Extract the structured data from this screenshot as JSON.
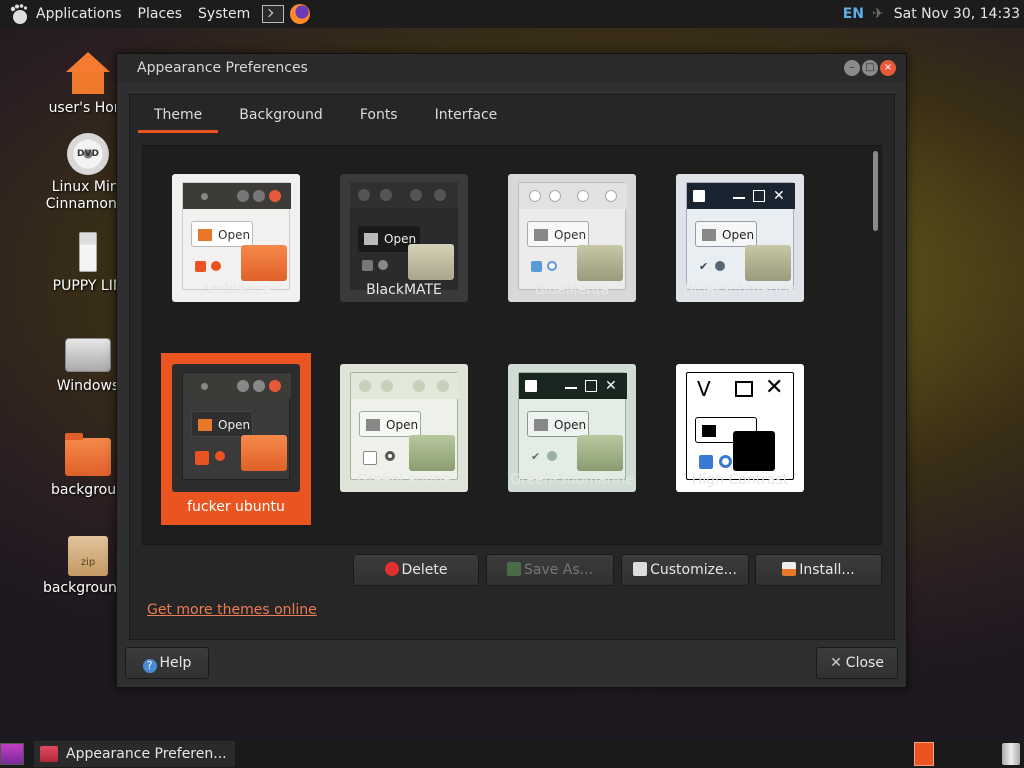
{
  "top_panel": {
    "menus": [
      "Applications",
      "Places",
      "System"
    ],
    "lang": "EN",
    "clock": "Sat Nov 30, 14:33"
  },
  "desktop": {
    "icons": [
      "user's Hom",
      "Linux Mint",
      "Cinnamon 6",
      "PUPPY LIN",
      "Windows",
      "backgroun",
      "backgrounds"
    ]
  },
  "window": {
    "title": "Appearance Preferences",
    "tabs": [
      "Theme",
      "Background",
      "Fonts",
      "Interface"
    ],
    "themes": [
      {
        "name": "Ambiance"
      },
      {
        "name": "BlackMATE"
      },
      {
        "name": "BlueMenta"
      },
      {
        "name": "Blue-Submarine"
      },
      {
        "name": "fucker ubuntu"
      },
      {
        "name": "GreenLaguna"
      },
      {
        "name": "Green-Submarine"
      },
      {
        "name": "High Contrast"
      }
    ],
    "mini_open_label": "Open",
    "buttons": {
      "delete": "Delete",
      "save_as": "Save As...",
      "customize": "Customize...",
      "install": "Install..."
    },
    "more_link": "Get more themes online",
    "help": "Help",
    "close": "Close",
    "colors": {
      "accent": "#e95420",
      "link": "#ec7c55"
    }
  },
  "taskbar": {
    "task_label": "Appearance Preferen..."
  }
}
